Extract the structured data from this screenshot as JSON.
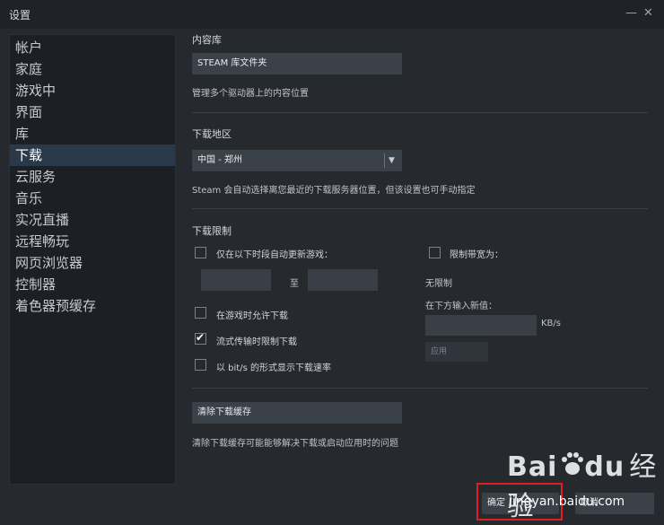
{
  "window": {
    "title": "设置",
    "minimize_glyph": "—",
    "close_glyph": "✕"
  },
  "sidebar": {
    "items": [
      {
        "label": "帐户"
      },
      {
        "label": "家庭"
      },
      {
        "label": "游戏中"
      },
      {
        "label": "界面"
      },
      {
        "label": "库"
      },
      {
        "label": "下载",
        "selected": true
      },
      {
        "label": "云服务"
      },
      {
        "label": "音乐"
      },
      {
        "label": "实况直播"
      },
      {
        "label": "远程畅玩"
      },
      {
        "label": "网页浏览器"
      },
      {
        "label": "控制器"
      },
      {
        "label": "着色器预缓存"
      }
    ]
  },
  "content_library": {
    "title": "内容库",
    "button": "STEAM 库文件夹",
    "desc": "管理多个驱动器上的内容位置"
  },
  "download_region": {
    "title": "下载地区",
    "selected": "中国 - 郑州",
    "desc": "Steam 会自动选择离您最近的下载服务器位置，但该设置也可手动指定"
  },
  "download_limits": {
    "title": "下载限制",
    "schedule_label": "仅在以下时段自动更新游戏：",
    "schedule_checked": false,
    "to_label": "至",
    "limit_bandwidth_label": "限制带宽为：",
    "limit_bandwidth_checked": false,
    "no_limit": "无限制",
    "enter_new_value": "在下方输入新值：",
    "unit": "KB/s",
    "apply_button": "应用",
    "options": [
      {
        "label": "在游戏时允许下载",
        "checked": false
      },
      {
        "label": "流式传输时限制下载",
        "checked": true
      },
      {
        "label": "以 bit/s 的形式显示下载速率",
        "checked": false
      }
    ]
  },
  "clear_cache": {
    "button": "清除下载缓存",
    "desc": "清除下载缓存可能能够解决下载或启动应用时的问题"
  },
  "footer": {
    "ok": "确定",
    "cancel": "取消"
  },
  "watermark": {
    "brand": "Bai",
    "brand2": "du",
    "chinese": "经验",
    "url": "jingyan.baidu.com"
  },
  "colors": {
    "selected_bg": "#2a3949",
    "highlight_box": "#e02020"
  }
}
